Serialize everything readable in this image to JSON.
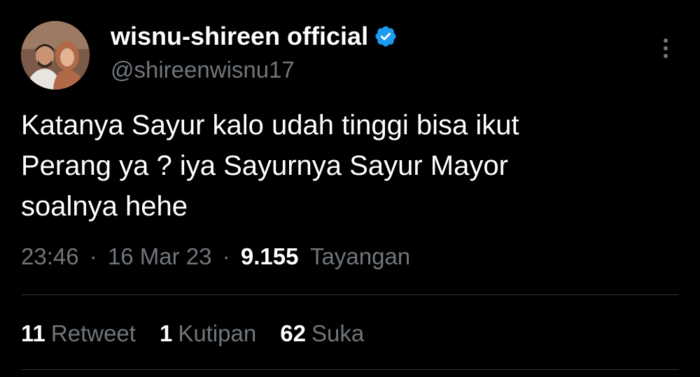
{
  "author": {
    "display_name": "wisnu-shireen official",
    "handle": "@shireenwisnu17",
    "verified": true,
    "verified_icon": "verified-badge-icon",
    "verified_color": "#1d9bf0"
  },
  "tweet": {
    "text": "Katanya Sayur kalo udah tinggi bisa ikut\nPerang ya ? iya Sayurnya Sayur Mayor\nsoalnya hehe",
    "time": "23:46",
    "date": "16 Mar 23",
    "views_count": "9.155",
    "views_label": "Tayangan",
    "separator": "·"
  },
  "stats": {
    "retweets_count": "11",
    "retweets_label": "Retweet",
    "quotes_count": "1",
    "quotes_label": "Kutipan",
    "likes_count": "62",
    "likes_label": "Suka"
  },
  "menu": {
    "icon": "more-vertical-icon"
  },
  "colors": {
    "background": "#000000",
    "text_primary": "#ffffff",
    "text_secondary": "#71767b",
    "divider": "#2f3336"
  }
}
